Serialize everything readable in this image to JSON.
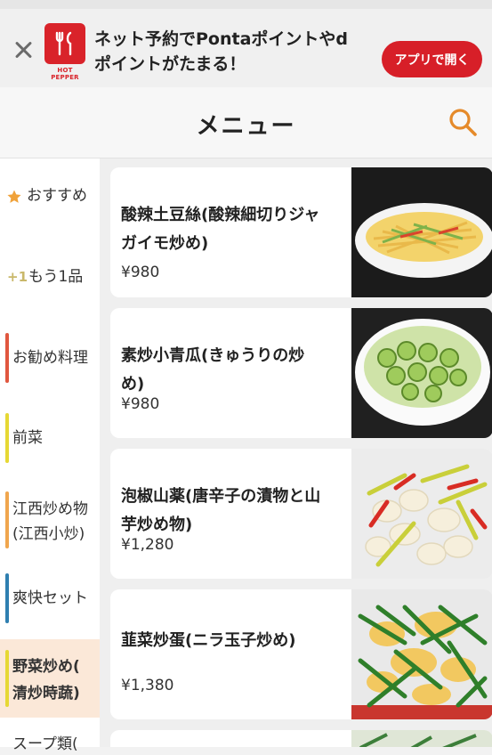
{
  "banner": {
    "logo_text": "HOT PEPPER",
    "message": "ネット予約でPontaポイントやdポイントがたまる！",
    "open_button": "アプリで開く"
  },
  "header": {
    "title": "メニュー"
  },
  "sidebar": {
    "items": [
      {
        "icon": "star-icon",
        "label": "おすすめ"
      },
      {
        "icon": "plus-one-icon",
        "prefix": "+1",
        "label": "もう1品"
      },
      {
        "label": "お勧め料理",
        "color": "#e0573f"
      },
      {
        "label": "前菜",
        "color": "#e6d834"
      },
      {
        "label": "江西炒め物(江西小炒)",
        "line1": "江西炒め物",
        "line2": "(江西小炒)",
        "color": "#f0a64e"
      },
      {
        "label": "爽快セット",
        "color": "#2f7fb0"
      },
      {
        "label": "野菜炒め(清炒時蔬)",
        "line1": "野菜炒め(",
        "line2": "清炒時蔬)",
        "color": "#e6d834",
        "active": true
      },
      {
        "label": "スープ類("
      }
    ]
  },
  "menu": {
    "items": [
      {
        "line1": "酸辣土豆絲(酸辣細切りジャ",
        "line2": "ガイモ炒め)",
        "price": "¥980"
      },
      {
        "line1": "素炒小青瓜(きゅうりの炒",
        "line2": "め)",
        "price": "¥980"
      },
      {
        "line1": "泡椒山薬(唐辛子の漬物と山",
        "line2": "芋炒め物)",
        "price": "¥1,280"
      },
      {
        "line1": "韮菜炒蛋(ニラ玉子炒め)",
        "line2": "",
        "price": "¥1,380"
      }
    ]
  },
  "colors": {
    "accent": "#d71f28",
    "search": "#e58a2a",
    "active_bg": "#fbe8d8"
  }
}
